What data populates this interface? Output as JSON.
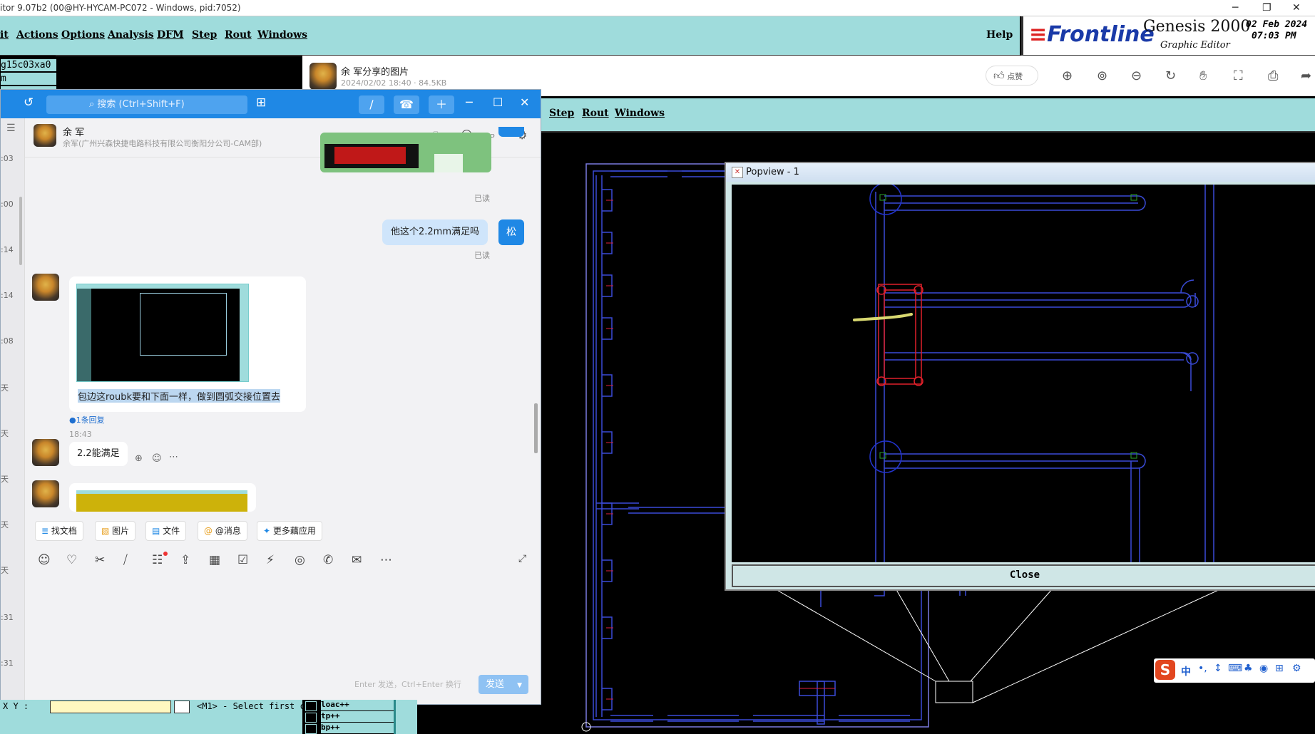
{
  "genesis": {
    "title": "itor 9.07b2 (00@HY-HYCAM-PC072 - Windows, pid:7052)",
    "menu": [
      "it",
      "Actions",
      "Options",
      "Analysis",
      "DFM",
      "Step",
      "Rout",
      "Windows"
    ],
    "help": "Help",
    "brand": "Frontline",
    "product": "Genesis 2000",
    "subtitle": "Graphic Editor",
    "date": "02 Feb 2024",
    "time": "07:03 PM",
    "left_rows": [
      "g15c03xa0",
      "m"
    ],
    "xy_label": "X Y :",
    "status_prompt": "<M1> - Select first c",
    "layers": [
      "loac++",
      "tp++",
      "bp++"
    ]
  },
  "viewer": {
    "title": "余 军分享的图片",
    "meta": "2024/02/02 18:40 · 84.5KB",
    "like": "点赞"
  },
  "nested": {
    "menu": [
      "Step",
      "Rout",
      "Windows"
    ]
  },
  "popview": {
    "title": "Popview - 1",
    "close": "Close"
  },
  "chat": {
    "search_placeholder": "搜索 (Ctrl+Shift+F)",
    "contact_name": "余 军",
    "contact_org": "余军(广州兴森快捷电路科技有限公司衡阳分公司-CAM部)",
    "left_times": [
      ":03",
      ":00",
      ":14",
      ":14",
      ":08",
      "天",
      "天",
      "天",
      "天",
      "天",
      ":31",
      ":31"
    ],
    "messages": {
      "read1": "已读",
      "my_question": "他这个2.2mm满足吗",
      "my_avatar": "松",
      "read2": "已读",
      "their_caption": "包边这roubk要和下面一样，做到圆弧交接位置去",
      "reply_count": "1条回复",
      "time": "18:43",
      "their_answer": "2.2能满足"
    },
    "quick": [
      "找文档",
      "图片",
      "文件",
      "@消息",
      "更多藕应用"
    ],
    "input_hint": "Enter 发送，Ctrl+Enter 换行",
    "send": "发送"
  },
  "ime": {
    "label": "中"
  }
}
